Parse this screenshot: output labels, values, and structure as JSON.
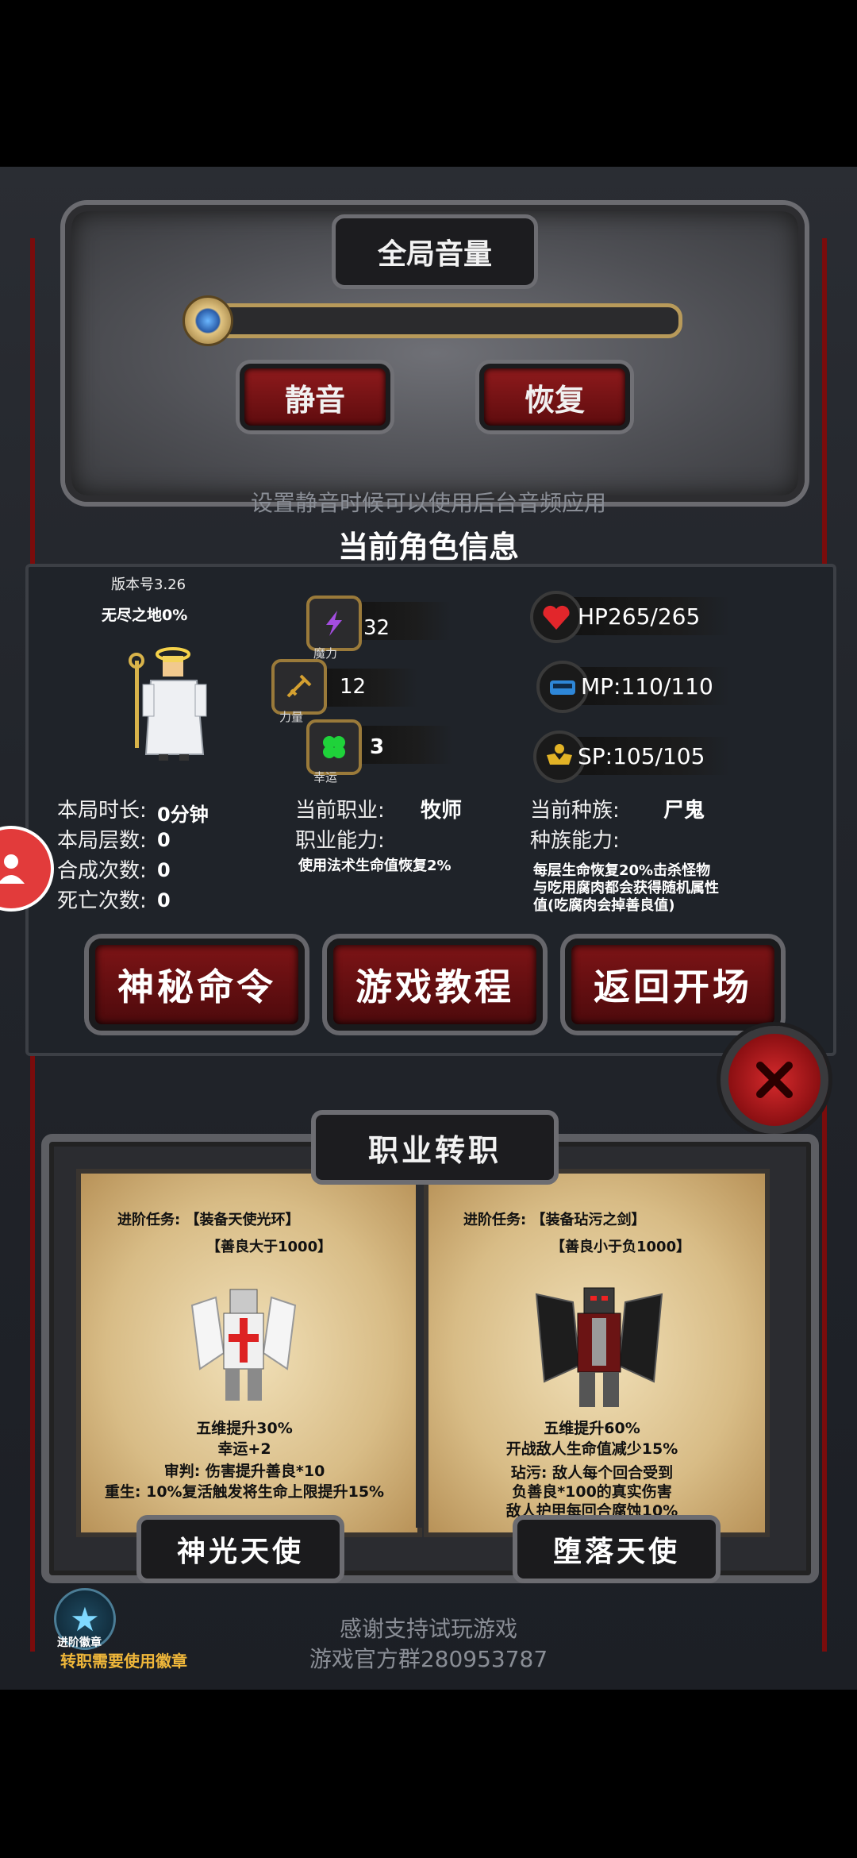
{
  "volume": {
    "title": "全局音量",
    "mute_label": "静音",
    "restore_label": "恢复",
    "hint": "设置静音时候可以使用后台音频应用"
  },
  "character": {
    "title": "当前角色信息",
    "version": "版本号3.26",
    "mode": "无尽之地0%",
    "stats": {
      "magic": {
        "value": "32",
        "label": "魔力"
      },
      "strength": {
        "value": "12",
        "label": "力量"
      },
      "luck": {
        "value": "3",
        "label": "幸运"
      }
    },
    "resources": {
      "hp": "HP265/265",
      "mp": "MP:110/110",
      "sp": "SP:105/105"
    },
    "run_info": [
      {
        "label": "本局时长:",
        "value": "0分钟"
      },
      {
        "label": "本局层数:",
        "value": "0"
      },
      {
        "label": "合成次数:",
        "value": "0"
      },
      {
        "label": "死亡次数:",
        "value": "0"
      }
    ],
    "job": {
      "label": "当前职业:",
      "value": "牧师",
      "ability_label": "职业能力:",
      "ability_desc": "使用法术生命值恢复2%"
    },
    "race": {
      "label": "当前种族:",
      "value": "尸鬼",
      "ability_label": "种族能力:",
      "ability_desc_1": "每层生命恢复20%击杀怪物",
      "ability_desc_2": "与吃用腐肉都会获得随机属性",
      "ability_desc_3": "值(吃腐肉会掉善良值)"
    },
    "buttons": {
      "secret": "神秘命令",
      "tutorial": "游戏教程",
      "back": "返回开场"
    }
  },
  "class_change": {
    "title": "职业转职",
    "left": {
      "quest_1": "进阶任务: 【装备天使光环】",
      "quest_2": "【善良大于1000】",
      "bonus_1": "五维提升30%",
      "bonus_2": "幸运+2",
      "bonus_3": "审判: 伤害提升善良*10",
      "bonus_4": "重生: 10%复活触发将生命上限提升15%",
      "name": "神光天使"
    },
    "right": {
      "quest_1": "进阶任务: 【装备玷污之剑】",
      "quest_2": "【善良小于负1000】",
      "bonus_1": "五维提升60%",
      "bonus_2": "开战敌人生命值减少15%",
      "bonus_3": "玷污: 敌人每个回合受到",
      "bonus_4": "负善良*100的真实伤害",
      "bonus_5": "敌人护甲每回合腐蚀10%",
      "name": "堕落天使"
    }
  },
  "footer": {
    "thanks": "感谢支持试玩游戏",
    "group": "游戏官方群280953787",
    "badge_label": "进阶徽章",
    "badge_hint": "转职需要使用徽章"
  }
}
